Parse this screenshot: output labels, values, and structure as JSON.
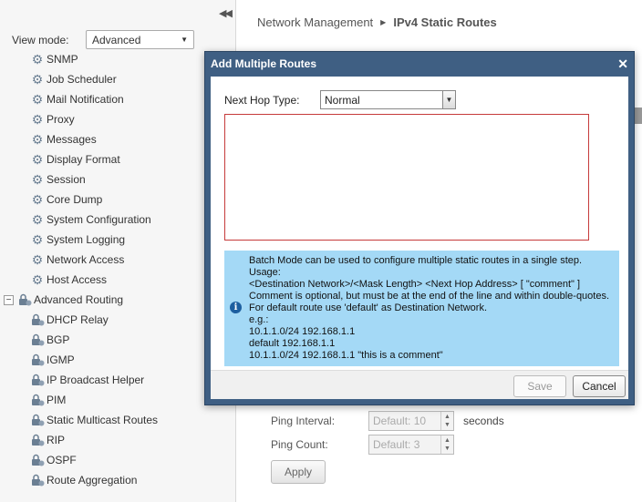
{
  "sidebar": {
    "collapse_icon": "double-chevron-left-icon",
    "view_mode_label": "View mode:",
    "view_mode_value": "Advanced",
    "items": [
      {
        "label": "SNMP",
        "icon": "gear-icon"
      },
      {
        "label": "Job Scheduler",
        "icon": "gear-icon"
      },
      {
        "label": "Mail Notification",
        "icon": "gear-icon"
      },
      {
        "label": "Proxy",
        "icon": "gear-icon"
      },
      {
        "label": "Messages",
        "icon": "gear-icon"
      },
      {
        "label": "Display Format",
        "icon": "gear-icon"
      },
      {
        "label": "Session",
        "icon": "gear-icon"
      },
      {
        "label": "Core Dump",
        "icon": "gear-icon"
      },
      {
        "label": "System Configuration",
        "icon": "gear-icon"
      },
      {
        "label": "System Logging",
        "icon": "gear-icon"
      },
      {
        "label": "Network Access",
        "icon": "gear-icon"
      },
      {
        "label": "Host Access",
        "icon": "gear-icon"
      }
    ],
    "group": {
      "label": "Advanced Routing",
      "expander": "⊟"
    },
    "group_items": [
      {
        "label": "DHCP Relay"
      },
      {
        "label": "BGP"
      },
      {
        "label": "IGMP"
      },
      {
        "label": "IP Broadcast Helper"
      },
      {
        "label": "PIM"
      },
      {
        "label": "Static Multicast Routes"
      },
      {
        "label": "RIP"
      },
      {
        "label": "OSPF"
      },
      {
        "label": "Route Aggregation"
      }
    ]
  },
  "header": {
    "breadcrumb_parent": "Network Management",
    "breadcrumb_current": "IPv4 Static Routes"
  },
  "background_form": {
    "ping_interval_label": "Ping Interval:",
    "ping_interval_placeholder": "Default: 10",
    "ping_interval_unit": "seconds",
    "ping_count_label": "Ping Count:",
    "ping_count_placeholder": "Default: 3",
    "apply_label": "Apply"
  },
  "dialog": {
    "title": "Add Multiple Routes",
    "close_glyph": "✕",
    "next_hop_label": "Next Hop Type:",
    "next_hop_value": "Normal",
    "textarea_value": "",
    "info_lines": [
      "Batch Mode can be used to configure multiple static routes in a single step.",
      "Usage:",
      "<Destination Network>/<Mask Length> <Next Hop Address> [ \"comment\" ]",
      "Comment is optional, but must be at the end of the line and within double-quotes.",
      "For default route use 'default' as Destination Network.",
      "e.g.:",
      "10.1.1.0/24 192.168.1.1",
      "default 192.168.1.1",
      "10.1.1.0/24 192.168.1.1 \"this is a comment\""
    ],
    "save_label": "Save",
    "cancel_label": "Cancel"
  },
  "colors": {
    "dialog_titlebar": "#3f5f83",
    "info_background": "#a4d9f6",
    "textarea_border": "#c63b3b"
  }
}
